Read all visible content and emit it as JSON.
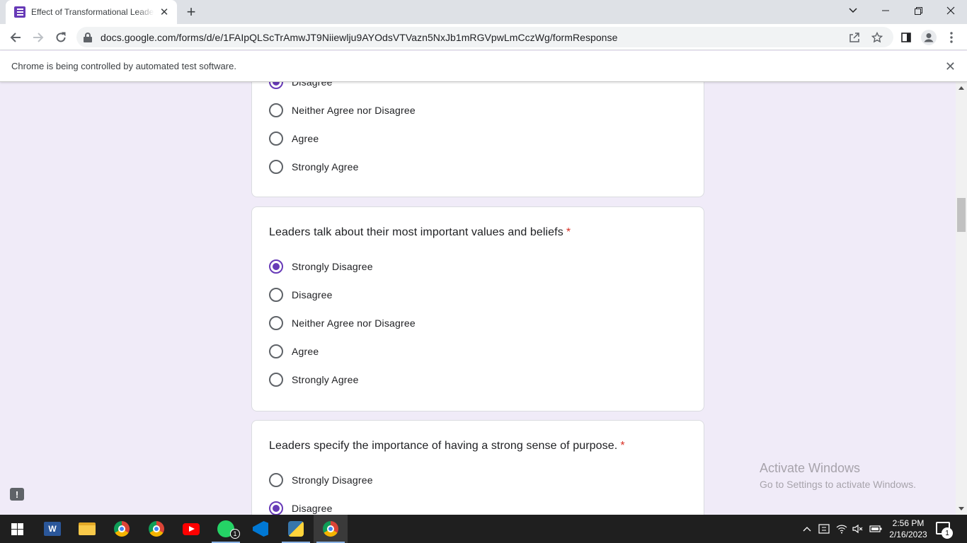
{
  "browser": {
    "tab_title": "Effect of Transformational Leadership",
    "tab_close_glyph": "✕",
    "new_tab_glyph": "+",
    "url": "docs.google.com/forms/d/e/1FAIpQLScTrAmwJT9Niiewlju9AYOdsVTVazn5NxJb1mRGVpwLmCczWg/formResponse",
    "infobar_text": "Chrome is being controlled by automated test software.",
    "infobar_close": "✕"
  },
  "form": {
    "partial_card": {
      "options": [
        {
          "label": "Disagree",
          "checked": true
        },
        {
          "label": "Neither Agree nor Disagree",
          "checked": false
        },
        {
          "label": "Agree",
          "checked": false
        },
        {
          "label": "Strongly Agree",
          "checked": false
        }
      ]
    },
    "q1": {
      "question": "Leaders talk about their most important values and beliefs",
      "required_mark": "*",
      "options": [
        {
          "label": "Strongly Disagree",
          "checked": true
        },
        {
          "label": "Disagree",
          "checked": false
        },
        {
          "label": "Neither Agree nor Disagree",
          "checked": false
        },
        {
          "label": "Agree",
          "checked": false
        },
        {
          "label": "Strongly Agree",
          "checked": false
        }
      ]
    },
    "q2": {
      "question": "Leaders specify the importance of having a strong sense of purpose.",
      "required_mark": "*",
      "options": [
        {
          "label": "Strongly Disagree",
          "checked": false
        },
        {
          "label": "Disagree",
          "checked": true
        }
      ]
    }
  },
  "watermark": {
    "line1": "Activate Windows",
    "line2": "Go to Settings to activate Windows."
  },
  "taskbar": {
    "word_letter": "W",
    "whatsapp_badge": "1",
    "time": "2:56 PM",
    "date": "2/16/2023",
    "notification_count": "1"
  },
  "colors": {
    "accent": "#673ab7",
    "page_background": "#f0ebf8",
    "required": "#d93025"
  }
}
